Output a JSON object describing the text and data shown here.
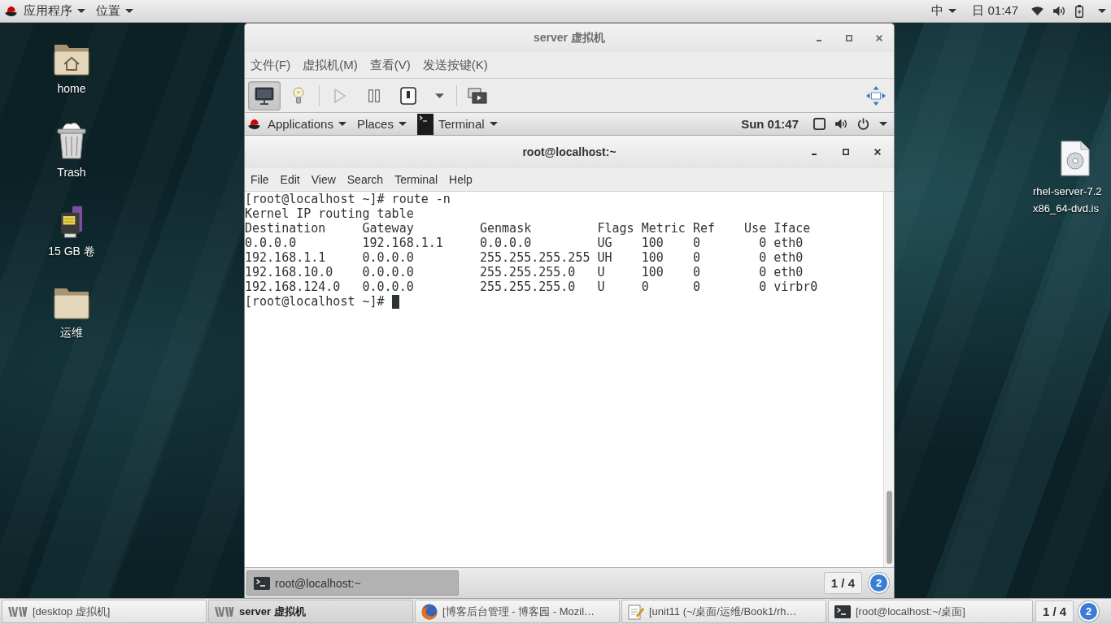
{
  "top_panel": {
    "menus": [
      {
        "label": "应用程序"
      },
      {
        "label": "位置"
      }
    ],
    "input_method": "中",
    "clock": "日 01:47"
  },
  "desktop_icons": [
    {
      "kind": "home",
      "label": "home"
    },
    {
      "kind": "trash",
      "label": "Trash"
    },
    {
      "kind": "drive",
      "label": "15 GB 卷"
    },
    {
      "kind": "folder",
      "label": "运维"
    }
  ],
  "desktop_icons_right": [
    {
      "kind": "disc",
      "label_lines": [
        "rhel-server-7.2",
        "x86_64-dvd.is"
      ]
    }
  ],
  "vm_window": {
    "title": "server 虚拟机",
    "menu": [
      "文件(F)",
      "虚拟机(M)",
      "查看(V)",
      "发送按键(K)"
    ],
    "toolbar": [
      [
        {
          "kind": "console",
          "selected": true,
          "disabled": false
        },
        {
          "kind": "details",
          "selected": false,
          "disabled": false
        }
      ],
      [
        {
          "kind": "run",
          "selected": false,
          "disabled": true
        },
        {
          "kind": "pause",
          "selected": false,
          "disabled": false
        },
        {
          "kind": "shutdown",
          "selected": false,
          "disabled": false
        },
        {
          "kind": "shutdown_menu",
          "selected": false,
          "disabled": false
        }
      ],
      [
        {
          "kind": "snapshots",
          "selected": false,
          "disabled": false
        }
      ]
    ],
    "guest": {
      "panel": {
        "menus": [
          "Applications",
          "Places"
        ],
        "window_menu": "Terminal",
        "clock": "Sun 01:47"
      },
      "terminal": {
        "title": "root@localhost:~",
        "menu": [
          "File",
          "Edit",
          "View",
          "Search",
          "Terminal",
          "Help"
        ],
        "lines": [
          {
            "text": "[root@localhost ~]# route -n",
            "cursor": false
          },
          {
            "text": "Kernel IP routing table",
            "cursor": false
          },
          {
            "text": "Destination     Gateway         Genmask         Flags Metric Ref    Use Iface",
            "cursor": false
          },
          {
            "text": "0.0.0.0         192.168.1.1     0.0.0.0         UG    100    0        0 eth0",
            "cursor": false
          },
          {
            "text": "192.168.1.1     0.0.0.0         255.255.255.255 UH    100    0        0 eth0",
            "cursor": false
          },
          {
            "text": "192.168.10.0    0.0.0.0         255.255.255.0   U     100    0        0 eth0",
            "cursor": false
          },
          {
            "text": "192.168.124.0   0.0.0.0         255.255.255.0   U     0      0        0 virbr0",
            "cursor": false
          },
          {
            "text": "[root@localhost ~]#",
            "cursor": true
          }
        ]
      },
      "bottom_panel": {
        "tasks": [
          {
            "label": "root@localhost:~",
            "selected": true
          }
        ],
        "pager": "1 / 4",
        "badge": "2"
      }
    }
  },
  "taskbar": {
    "tasks": [
      {
        "kind": "vm",
        "label": "[desktop 虚拟机]",
        "selected": false
      },
      {
        "kind": "vm",
        "label": "server 虚拟机",
        "selected": true
      },
      {
        "kind": "browser",
        "label": "[博客后台管理 - 博客园 - Mozil…",
        "selected": false
      },
      {
        "kind": "editor",
        "label": "[unit11 (~/桌面/运维/Book1/rh…",
        "selected": false
      },
      {
        "kind": "terminal",
        "label": "[root@localhost:~/桌面]",
        "selected": false
      }
    ],
    "pager": "1 / 4",
    "badge": "2"
  }
}
